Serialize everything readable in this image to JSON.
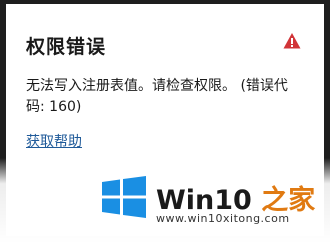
{
  "dialog": {
    "title": "权限错误",
    "message": "无法写入注册表值。请检查权限。 (错误代码: 160)",
    "help_link": "获取帮助",
    "warning_icon": "warning-triangle-icon",
    "warning_color": "#d13438"
  },
  "watermark": {
    "brand_main": "Win10 ",
    "brand_accent": "之家",
    "url": "www.win10xitong.com",
    "logo_icon": "windows-logo-icon",
    "logo_color": "#1a8fe3"
  }
}
